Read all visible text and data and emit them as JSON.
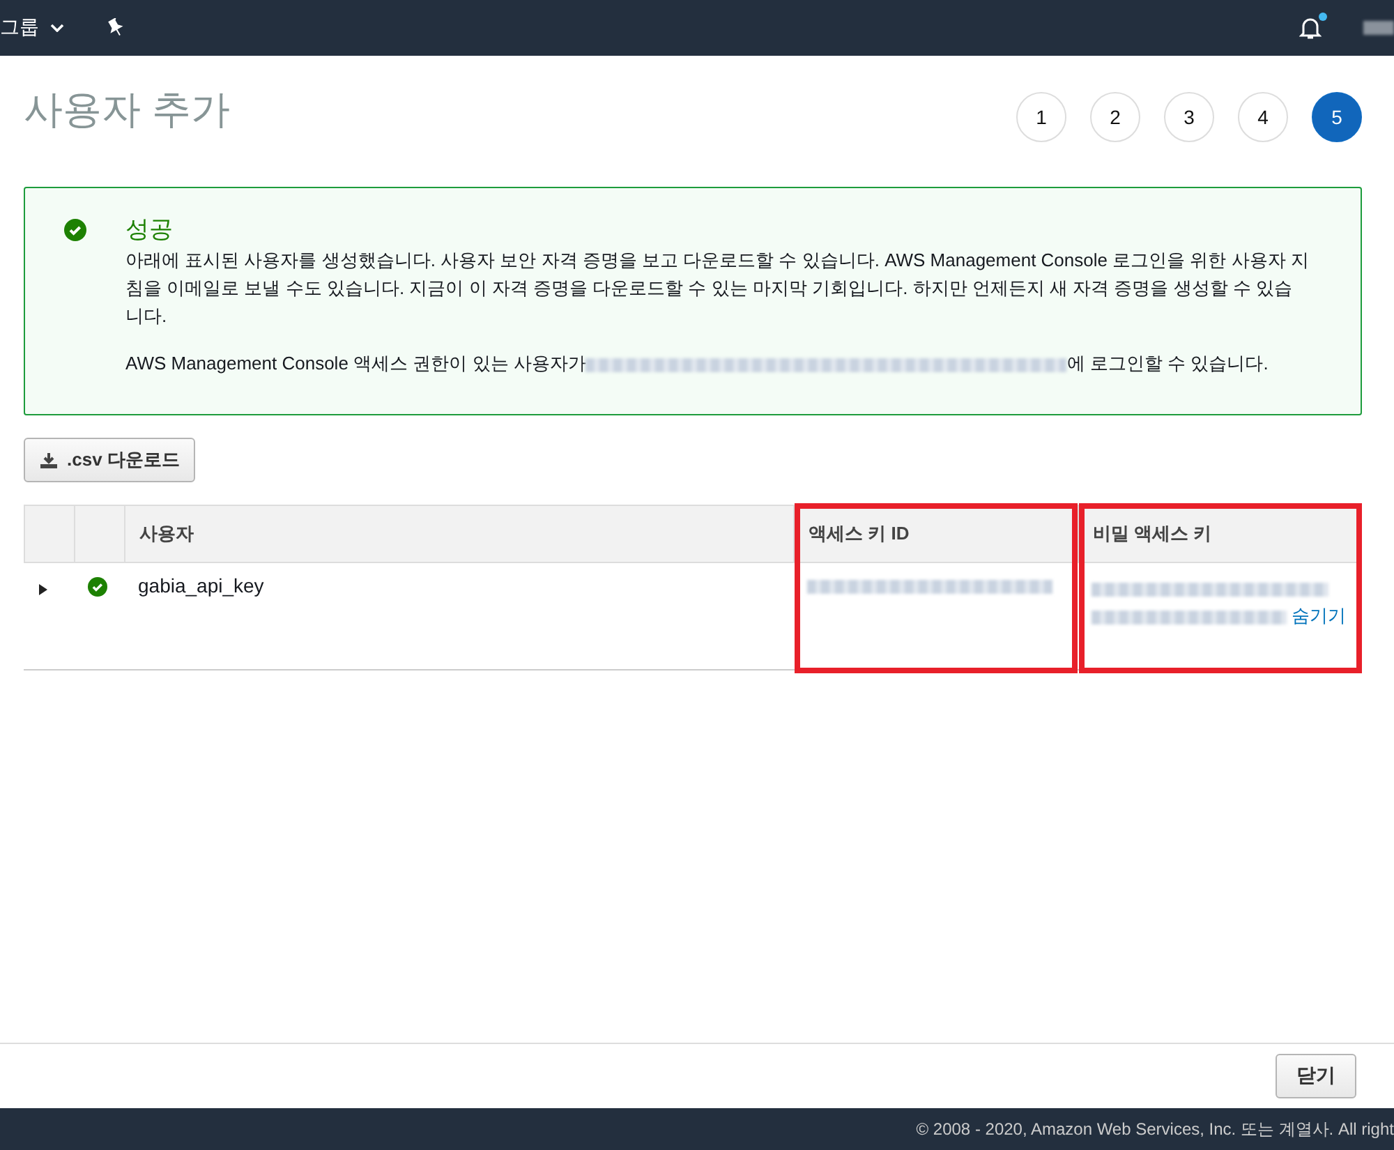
{
  "top_bar": {
    "menu_label": "그룹",
    "notifications_unread": true
  },
  "page": {
    "title": "사용자 추가"
  },
  "steps": [
    {
      "label": "1",
      "selected": false
    },
    {
      "label": "2",
      "selected": false
    },
    {
      "label": "3",
      "selected": false
    },
    {
      "label": "4",
      "selected": false
    },
    {
      "label": "5",
      "selected": true
    }
  ],
  "alert": {
    "title": "성공",
    "message": "아래에 표시된 사용자를 생성했습니다. 사용자 보안 자격 증명을 보고 다운로드할 수 있습니다. AWS Management Console 로그인을 위한 사용자 지침을 이메일로 보낼 수도 있습니다. 지금이 이 자격 증명을 다운로드할 수 있는 마지막 기회입니다. 하지만 언제든지 새 자격 증명을 생성할 수 있습니다.",
    "login_before": "AWS Management Console 액세스 권한이 있는 사용자가",
    "login_after": "에 로그인할 수 있습니다."
  },
  "download_button": ".csv 다운로드",
  "table": {
    "columns": [
      {
        "label": "사용자",
        "highlighted": false
      },
      {
        "label": "액세스 키 ID",
        "highlighted": true
      },
      {
        "label": "비밀 액세스 키",
        "highlighted": true
      }
    ],
    "rows": [
      {
        "user": "gabia_api_key",
        "expanded": false,
        "success": true,
        "hide_link": "숨기기"
      }
    ]
  },
  "close_button": "닫기",
  "footer": "© 2008 - 2020, Amazon Web Services, Inc. 또는 계열사. All right"
}
